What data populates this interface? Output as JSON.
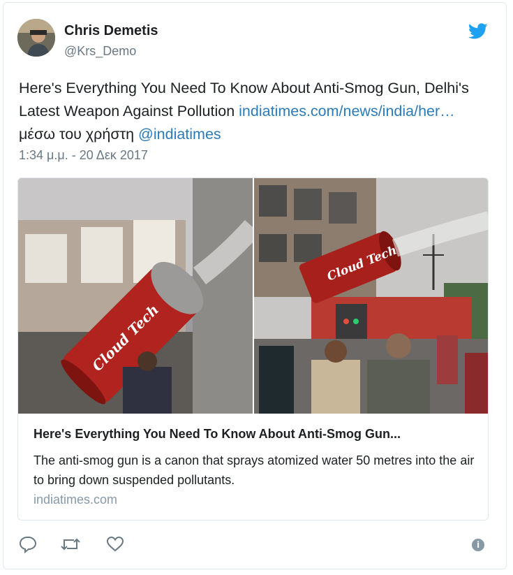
{
  "author": {
    "name": "Chris Demetis",
    "handle": "@Krs_Demo"
  },
  "tweet": {
    "text_before": "Here's Everything You Need To Know About Anti-Smog Gun, Delhi's Latest Weapon Against Pollution ",
    "link_text": "indiatimes.com/news/india/her…",
    "via_text": " μέσω του χρήστη ",
    "mention": "@indiatimes",
    "timestamp": "1:34 μ.μ. - 20 Δεκ 2017"
  },
  "link_card": {
    "title": "Here's Everything You Need To Know About Anti-Smog Gun...",
    "description": "The anti-smog gun is a canon that sprays atomized water 50 metres into the air to bring down suspended pollutants.",
    "domain": "indiatimes.com",
    "image_lettering_left": "Cloud Tech",
    "image_lettering_right": "Cloud Tech"
  },
  "actions": {
    "reply_icon": "reply-icon",
    "retweet_icon": "retweet-icon",
    "like_icon": "heart-icon",
    "info_icon": "info-icon",
    "info_glyph": "i"
  },
  "colors": {
    "link": "#2b7bb9",
    "twitter_blue": "#1da1f2",
    "muted": "#697882"
  }
}
